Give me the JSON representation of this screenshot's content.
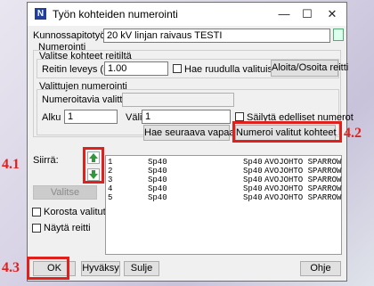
{
  "window": {
    "title": "Työn kohteiden numerointi"
  },
  "header": {
    "maintenance_label": "Kunnossapitotyö",
    "maintenance_value": "20 kV linjan raivaus TESTI"
  },
  "numbering": {
    "group_label": "Numerointi",
    "route_group_label": "Valitse kohteet reitiltä",
    "width_label": "Reitin leveys (m)",
    "width_value": "1.00",
    "grid_search_label": "Hae ruudulla valituista",
    "start_button": "Aloita/Osoita reitti",
    "selected_group_label": "Valittujen numerointi",
    "numerable_label": "Numeroitavia valittu",
    "numerable_value": "",
    "start_label": "Alku",
    "start_value": "1",
    "interval_label": "Väli",
    "interval_value": "1",
    "keep_previous_label": "Säilytä edelliset numerot",
    "next_free_button": "Hae seuraava vapaa väli",
    "number_selected_button": "Numeroi valitut kohteet"
  },
  "move": {
    "label": "Siirrä:",
    "up_icon": "arrow-up-icon",
    "down_icon": "arrow-down-icon",
    "select_button": "Valitse",
    "highlight_label": "Korosta valitut",
    "show_route_label": "Näytä reitti"
  },
  "list": {
    "rows": [
      {
        "num": "1",
        "code": "Sp40",
        "code2": "Sp40",
        "desc": "AVOJOHTO SPARROW"
      },
      {
        "num": "2",
        "code": "Sp40",
        "code2": "Sp40",
        "desc": "AVOJOHTO SPARROW"
      },
      {
        "num": "3",
        "code": "Sp40",
        "code2": "Sp40",
        "desc": "AVOJOHTO SPARROW"
      },
      {
        "num": "4",
        "code": "Sp40",
        "code2": "Sp40",
        "desc": "AVOJOHTO SPARROW"
      },
      {
        "num": "5",
        "code": "Sp40",
        "code2": "Sp40",
        "desc": "AVOJOHTO SPARROW"
      }
    ]
  },
  "footer": {
    "ok": "OK",
    "accept": "Hyväksy",
    "close": "Sulje",
    "help": "Ohje"
  },
  "annotations": {
    "a41": "4.1",
    "a42": "4.2",
    "a43": "4.3"
  },
  "colors": {
    "annotation": "#e0201c",
    "arrow_green": "#2e9a3a"
  }
}
